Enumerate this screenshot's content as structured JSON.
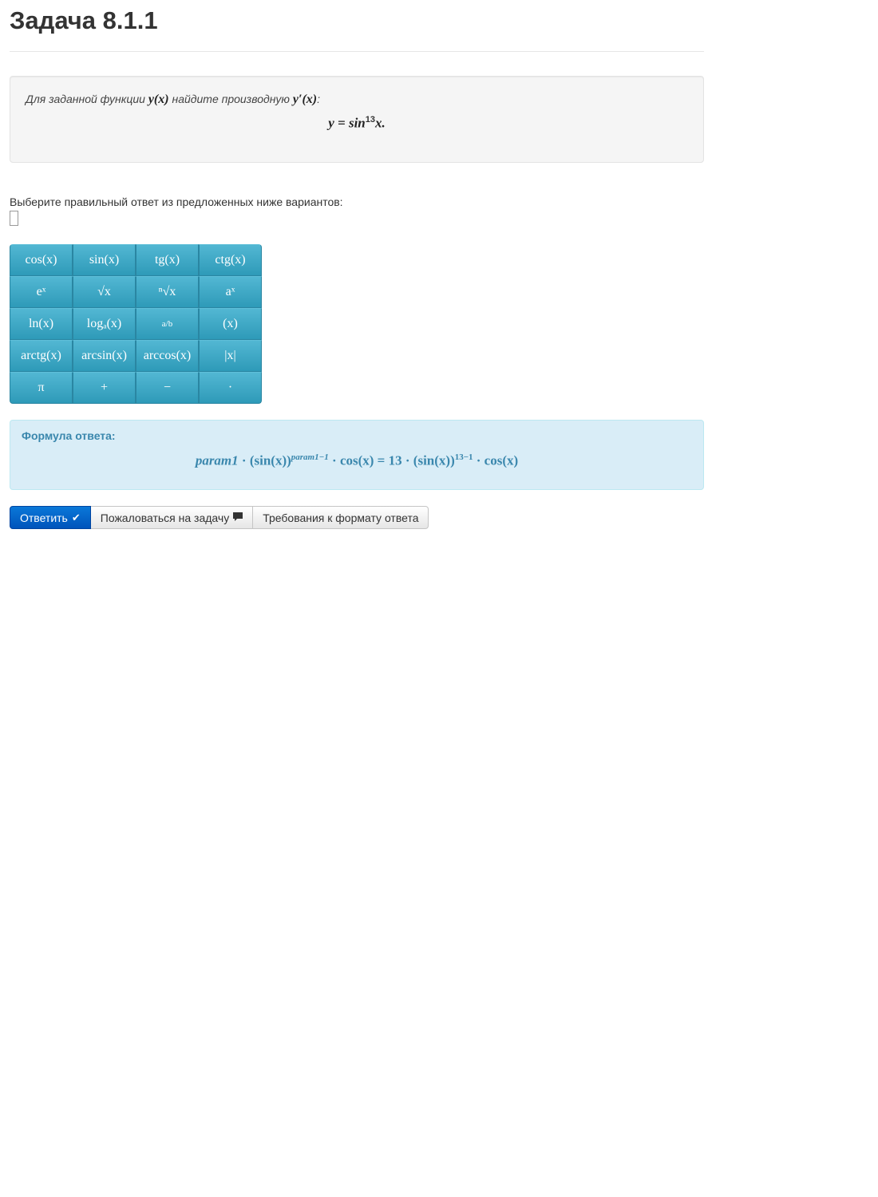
{
  "page": {
    "title": "Задача 8.1.1"
  },
  "problem": {
    "intro_text": "Для заданной функции",
    "intro_func": "y(x)",
    "intro_mid": "найдите производную",
    "intro_deriv": "y′(x)",
    "intro_end": ":",
    "display_lhs": "y = sin",
    "display_exp": "13",
    "display_rhs": "x."
  },
  "choose_text": "Выберите правильный ответ из предложенных ниже вариантов:",
  "answer_input": {
    "value": ""
  },
  "keypad": {
    "keys": [
      "cos(x)",
      "sin(x)",
      "tg(x)",
      "ctg(x)",
      "eˣ",
      "√x",
      "ⁿ√x",
      "aˣ",
      "ln(x)",
      "logₐ(x)",
      "a/b",
      "(x)",
      "arctg(x)",
      "arcsin(x)",
      "arccos(x)",
      "|x|",
      "π",
      "+",
      "−",
      "·"
    ]
  },
  "formula": {
    "label": "Формула ответа:",
    "p1": "param1",
    "p2": " · (sin(x))",
    "p2_exp": "param1−1",
    "p3": " · cos(x) = 13 · (sin(x))",
    "p3_exp": "13−1",
    "p4": " · cos(x)"
  },
  "buttons": {
    "submit": "Ответить",
    "submit_icon": "check-icon",
    "complain": "Пожаловаться на задачу",
    "complain_icon": "comment-icon",
    "format_req": "Требования к формату ответа"
  }
}
